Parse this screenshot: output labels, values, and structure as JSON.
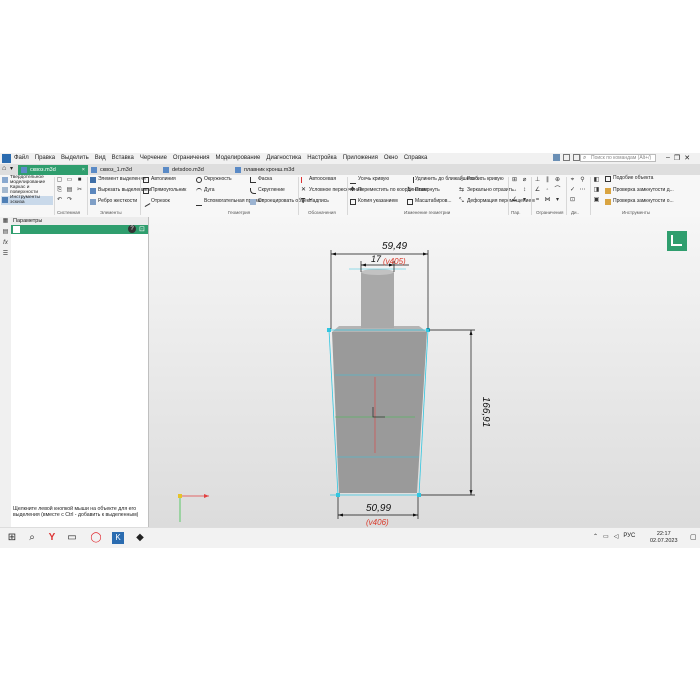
{
  "app": {
    "menu": [
      "Файл",
      "Правка",
      "Выделить",
      "Вид",
      "Вставка",
      "Черчение",
      "Ограничения",
      "Моделирование",
      "Диагностика",
      "Настройка",
      "Приложения",
      "Окно",
      "Справка"
    ],
    "search_placeholder": "Поиск по командам (Alt+/)"
  },
  "tabs": [
    {
      "label": "сквоз.m3d",
      "active": true
    },
    {
      "label": "сквоз_1.m3d",
      "active": false
    },
    {
      "label": "detsdoo.m3d",
      "active": false
    },
    {
      "label": "плавник кронш.m3d",
      "active": false
    }
  ],
  "ribbon": {
    "left_modes": [
      "Твердотельное моделирование",
      "Каркас и поверхности",
      "Инструменты эскиза"
    ],
    "groups": {
      "system": "Системная",
      "elements": "Элементы",
      "geometry": "Геометрия",
      "designations": "Обозначения",
      "edit_geometry": "Изменение геометрии",
      "par": "Пар.",
      "constraints": "Ограничения",
      "d": "Ди..",
      "tools": "Инструменты"
    },
    "elements_items": [
      "Элемент выделения",
      "Вырезать выделением",
      "Ребро жесткости"
    ],
    "geometry_col1": [
      "Автолиния",
      "Прямоугольник",
      "Отрезок"
    ],
    "geometry_col2": [
      "Окружность",
      "Дуга",
      "Вспомогательная прямая"
    ],
    "geometry_col3": [
      "Фаска",
      "Скругление",
      "Спроецировать объект"
    ],
    "designations_items": [
      "Автоосевая",
      "Условное пересечение",
      "Надпись"
    ],
    "edit_col1": [
      "Усечь кривую",
      "Переместить по координатам",
      "Копия указанием"
    ],
    "edit_col2": [
      "Удлинить до ближайшего о...",
      "Повернуть",
      "Масштабиров..."
    ],
    "edit_col3": [
      "Разбить кривую",
      "Зеркально отразить",
      "Деформация перемещением"
    ],
    "tools_items": [
      "Подобие объекта",
      "Проверка замкнутости д...",
      "Проверка замкнутости о..."
    ]
  },
  "panel": {
    "title": "Параметры",
    "hint": "Щелкните левой кнопкой мыши на объекте для его выделения (вместе с Ctrl - добавить к выделенным)"
  },
  "sketch": {
    "top_width": "59,49",
    "neck_width": "17",
    "neck_ref": "(v405)",
    "height": "166,91",
    "bottom_width": "50,99",
    "bottom_ref": "(v406)"
  },
  "taskbar": {
    "lang": "РУС",
    "time": "22:17",
    "date": "02.07.2023"
  },
  "colors": {
    "accent_green": "#2f9e6e",
    "dimension_black": "#111111",
    "reference_red": "#d93a2b",
    "construction_cyan": "#33c6e0"
  }
}
